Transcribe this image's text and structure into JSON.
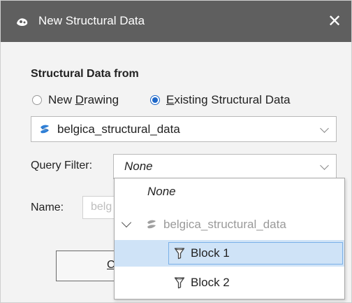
{
  "window": {
    "title": "New Structural Data",
    "close_glyph": "✕"
  },
  "structural_section": {
    "heading": "Structural Data from",
    "options": [
      {
        "label_pre": "New ",
        "label_u": "D",
        "label_post": "rawing",
        "checked": false
      },
      {
        "label_pre": "",
        "label_u": "E",
        "label_post": "xisting Structural Data",
        "checked": true
      }
    ]
  },
  "source_select": {
    "value": "belgica_structural_data",
    "icon": "structural-data-icon"
  },
  "query_filter": {
    "label": "Query Filter:",
    "value": "None"
  },
  "name_field": {
    "label": "Name:",
    "value_partial": "belg"
  },
  "cancel_button": {
    "label_partial": "Ca"
  },
  "dropdown": {
    "items": [
      {
        "label": "None",
        "type": "none"
      },
      {
        "label": "belgica_structural_data",
        "type": "parent",
        "icon": "structural-data-icon",
        "expander": "chevron-down"
      },
      {
        "label": "Block 1",
        "type": "filter",
        "icon": "filter-icon",
        "selected": true
      },
      {
        "label": "Block 2",
        "type": "filter",
        "icon": "filter-icon",
        "selected": false
      }
    ]
  },
  "colors": {
    "titlebar": "#5f5f5f",
    "accent": "#1e67c8",
    "selection": "#cfe3f7",
    "structural_icon_blue": "#2f7fd6"
  }
}
